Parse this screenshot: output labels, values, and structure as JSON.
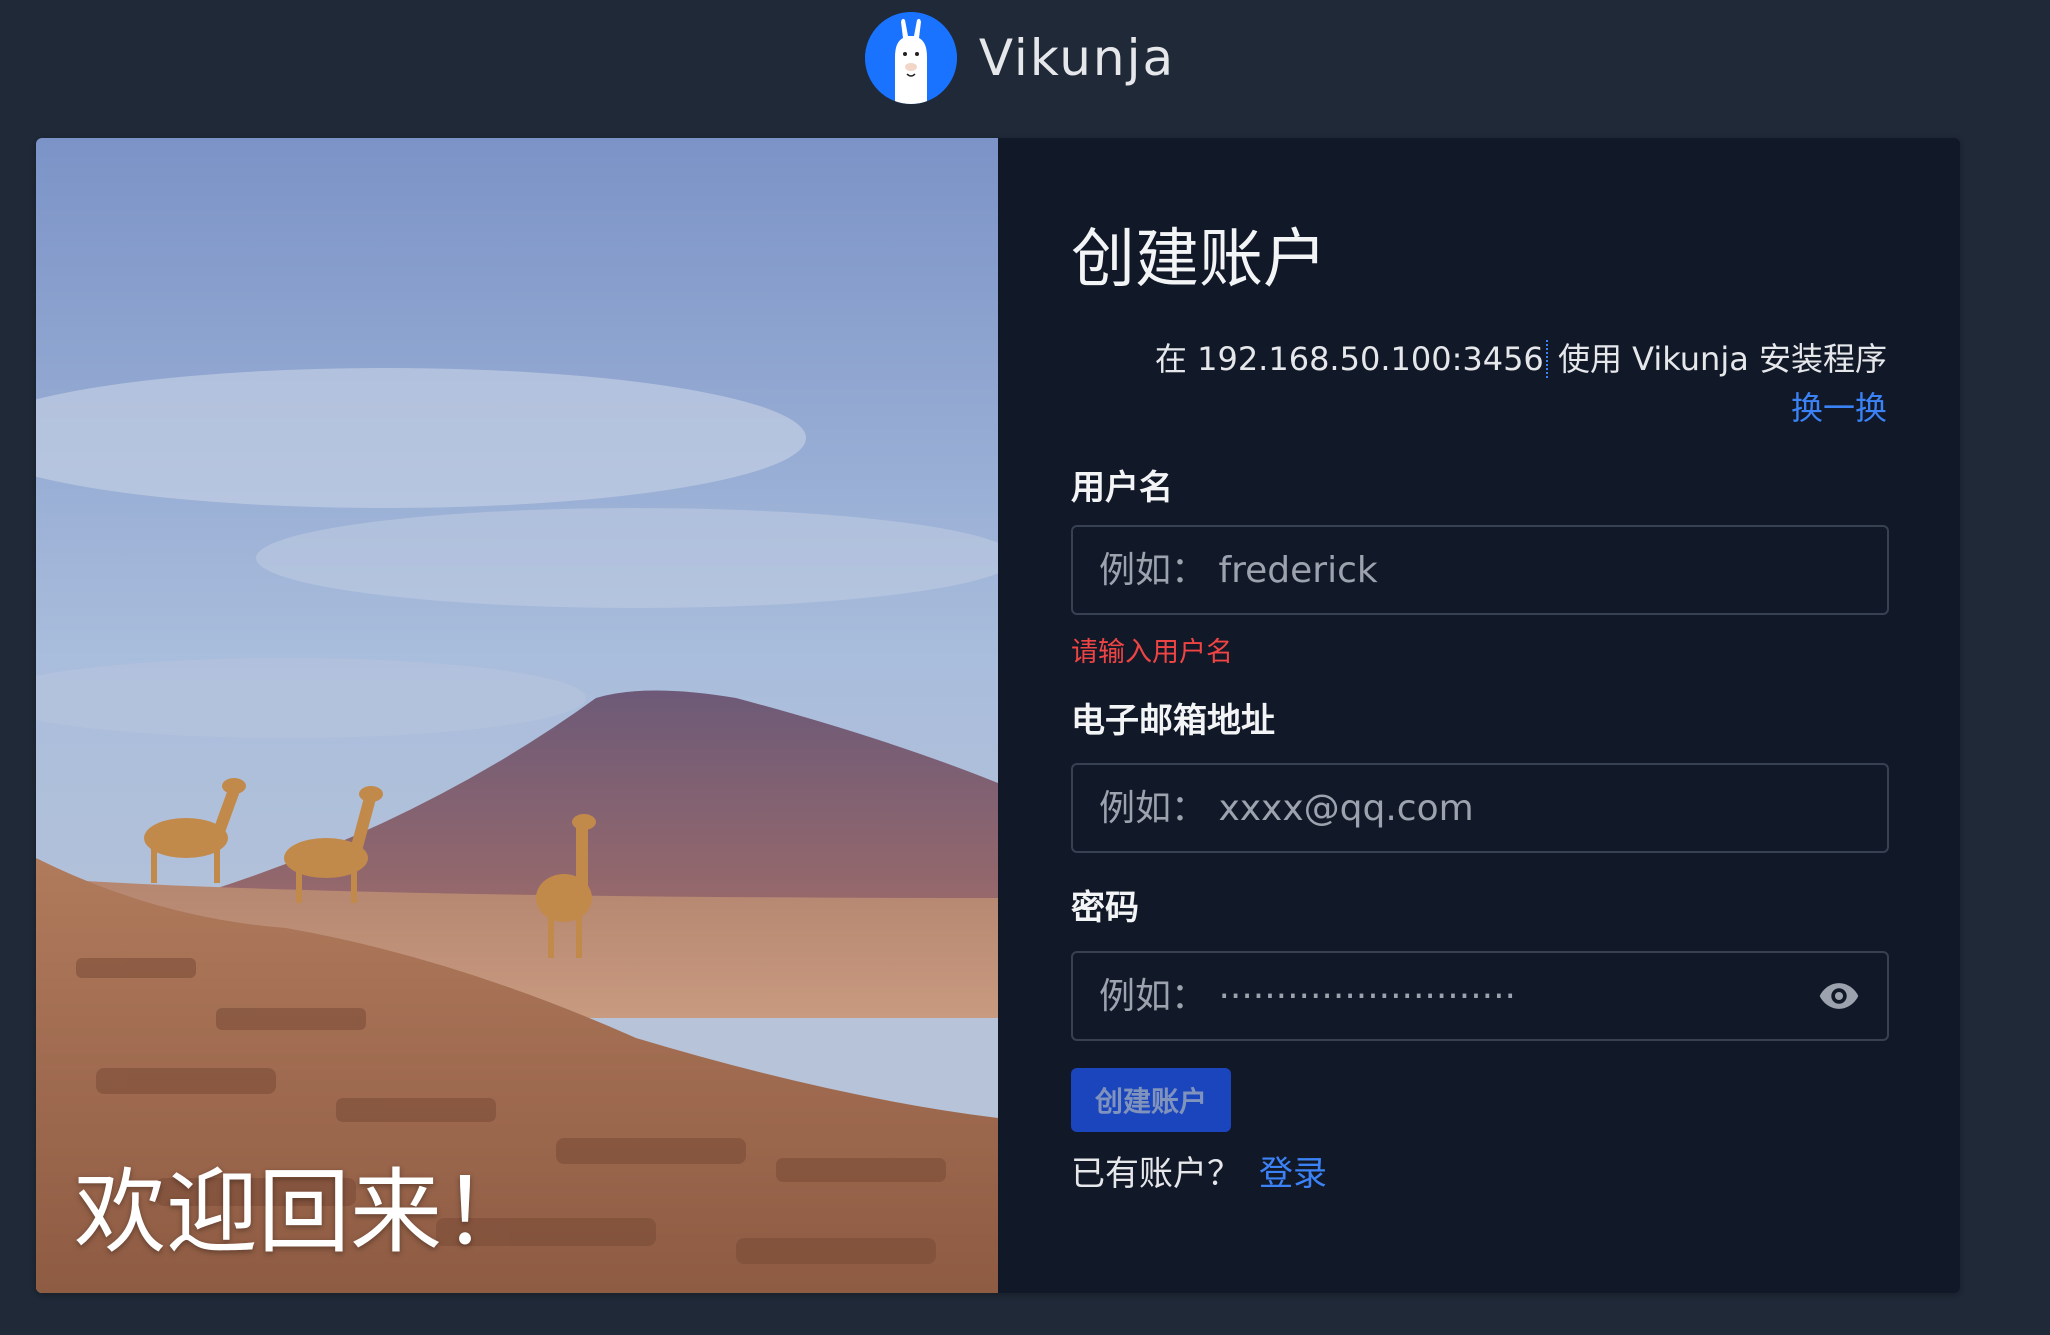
{
  "app": {
    "name": "Vikunja"
  },
  "hero": {
    "title": "欢迎回来！"
  },
  "form": {
    "title": "创建账户",
    "server_prefix": "在",
    "server_url": "192.168.50.100:3456",
    "server_suffix": "使用 Vikunja 安装程序",
    "change_link": "换一换",
    "username": {
      "label": "用户名",
      "placeholder": "例如： frederick",
      "error": "请输入用户名"
    },
    "email": {
      "label": "电子邮箱地址",
      "placeholder": "例如： xxxx@qq.com"
    },
    "password": {
      "label": "密码",
      "placeholder": "例如： ··························"
    },
    "submit_label": "创建账户",
    "have_account": "已有账户？",
    "login_label": "登录"
  },
  "colors": {
    "accent": "#3b82f6",
    "error": "#ef4444",
    "panel_bg": "#111827",
    "page_bg": "#1f2937",
    "logo": "#1973ff"
  },
  "icons": [
    "vikunja-llama-logo",
    "eye-icon"
  ]
}
